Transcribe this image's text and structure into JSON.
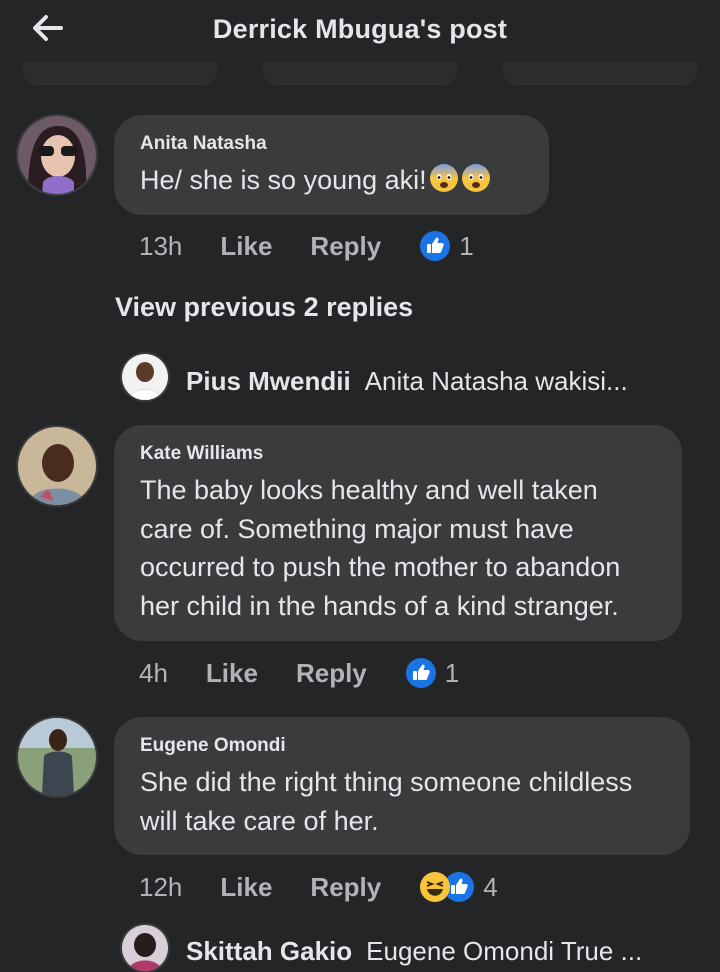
{
  "header": {
    "title": "Derrick Mbugua's post"
  },
  "comments": [
    {
      "author": "Anita Natasha",
      "text": "He/ she is so young aki!",
      "emojis": [
        "anxious-face-emoji",
        "anxious-face-emoji"
      ],
      "time": "13h",
      "like_label": "Like",
      "reply_label": "Reply",
      "reaction_count": "1"
    },
    {
      "author": "Kate Williams",
      "text": "The baby looks healthy and well taken\ncare of. Something major must have\noccurred to push the mother to abandon\nher child in the hands of a kind stranger.",
      "time": "4h",
      "like_label": "Like",
      "reply_label": "Reply",
      "reaction_count": "1"
    },
    {
      "author": "Eugene Omondi",
      "text": "She did the right thing someone childless\nwill take care of her.",
      "time": "12h",
      "like_label": "Like",
      "reply_label": "Reply",
      "reaction_count": "4"
    }
  ],
  "view_previous_replies": "View previous 2 replies",
  "reply_previews": [
    {
      "author": "Pius Mwendii",
      "text": "Anita Natasha wakisi..."
    },
    {
      "author": "Skittah Gakio",
      "text": "Eugene Omondi True ..."
    }
  ],
  "colors": {
    "background": "#242526",
    "bubble": "#3a3b3c",
    "text": "#e4e6eb",
    "muted": "#b0b3b8",
    "like_blue": "#1b74e4"
  }
}
